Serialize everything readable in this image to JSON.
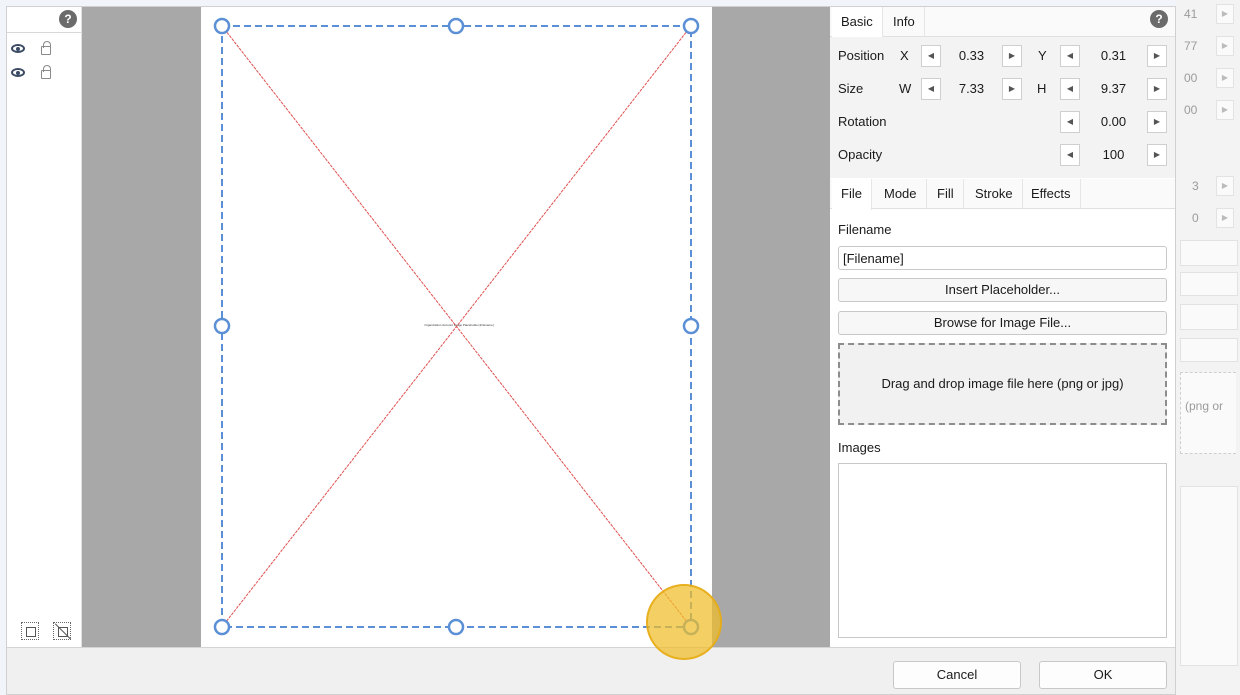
{
  "layer_panel": {
    "help_icon": "?",
    "layers": [
      {
        "visible": true,
        "locked": false
      },
      {
        "visible": true,
        "locked": false
      }
    ]
  },
  "canvas": {
    "placeholder_text": "Organization Account Image Placeholder [Filename]"
  },
  "properties": {
    "help_icon": "?",
    "tabs": [
      "Basic",
      "Info"
    ],
    "active_tab": "Basic",
    "position": {
      "label": "Position",
      "x_label": "X",
      "x": "0.33",
      "y_label": "Y",
      "y": "0.31"
    },
    "size": {
      "label": "Size",
      "w_label": "W",
      "w": "7.33",
      "h_label": "H",
      "h": "9.37"
    },
    "rotation": {
      "label": "Rotation",
      "value": "0.00"
    },
    "opacity": {
      "label": "Opacity",
      "value": "100"
    },
    "sub_tabs": [
      "File",
      "Mode",
      "Fill",
      "Stroke",
      "Effects"
    ],
    "active_sub_tab": "File",
    "filename_label": "Filename",
    "filename_value": "[Filename]",
    "insert_placeholder_label": "Insert Placeholder...",
    "browse_label": "Browse for Image File...",
    "dropzone_text": "Drag and drop image file here (png or jpg)",
    "images_label": "Images"
  },
  "footer": {
    "cancel_label": "Cancel",
    "ok_label": "OK"
  },
  "background": {
    "values": [
      "41",
      "77",
      "00",
      "00",
      "3",
      "0"
    ],
    "dropzone_fragment": "(png or"
  },
  "colors": {
    "accent": "#5b8fd6",
    "cross_lines": "#e05050",
    "cursor_highlight": "#f0be28"
  }
}
